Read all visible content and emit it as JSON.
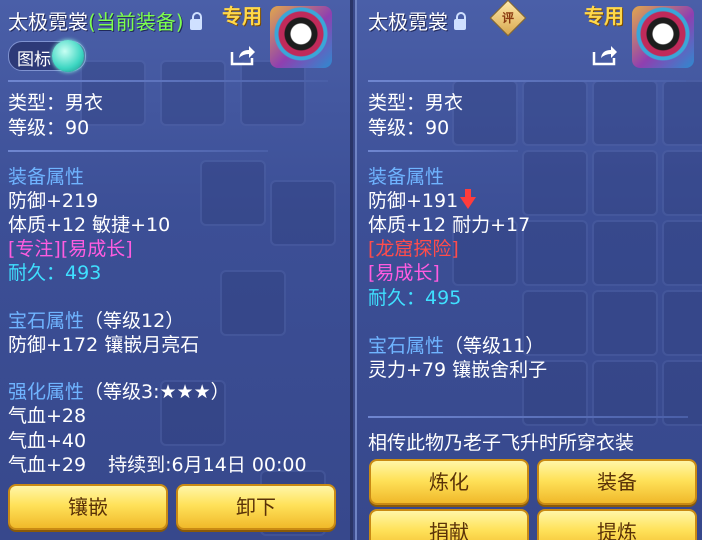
{
  "left": {
    "title_name": "太极霓裳",
    "title_status": "(当前装备)",
    "exclusive": "专用",
    "toggle_label": "图标",
    "type_line": "类型：男衣",
    "level_line": "等级：90",
    "equip_attr_title": "装备属性",
    "defense": "防御+219",
    "stats": "体质+12 敏捷+10",
    "tags": "[专注][易成长]",
    "durability_label": "耐久：",
    "durability_value": "493",
    "gem_title": "宝石属性",
    "gem_level": "（等级12）",
    "gem_line": "防御+172 镶嵌月亮石",
    "enhance_title": "强化属性",
    "enhance_level": "（等级3:★★★）",
    "hp1": "气血+28",
    "hp2": "气血+40",
    "hp3": "气血+29",
    "duration": "持续到:6月14日 00:00",
    "btn_inlay": "镶嵌",
    "btn_unequip": "卸下"
  },
  "right": {
    "title_name": "太极霓裳",
    "review_icon_text": "评",
    "exclusive": "专用",
    "type_line": "类型：男衣",
    "level_line": "等级：90",
    "equip_attr_title": "装备属性",
    "defense": "防御+191",
    "stats": "体质+12 耐力+17",
    "tag_red": "[龙窟探险]",
    "tag_pink": "[易成长]",
    "durability_label": "耐久：",
    "durability_value": "495",
    "gem_title": "宝石属性",
    "gem_level": "（等级11）",
    "gem_line": "灵力+79 镶嵌舍利子",
    "description": "相传此物乃老子飞升时所穿衣装",
    "btn_refine": "炼化",
    "btn_equip": "装备",
    "btn_donate": "捐献",
    "btn_extract": "提炼"
  },
  "colors": {
    "panel_bg": "#4a5fa8",
    "section_title": "#6fb4ff",
    "durability": "#3fe0ff",
    "tag_pink": "#ff5ce0",
    "tag_red": "#ff4c4c",
    "current_equip": "#7dff4f",
    "exclusive": "#ffd84a",
    "button": "#ffe25a"
  },
  "icons": [
    "lock-icon",
    "share-icon",
    "avatar-icon",
    "review-icon",
    "down-arrow-icon",
    "toggle-knob"
  ]
}
